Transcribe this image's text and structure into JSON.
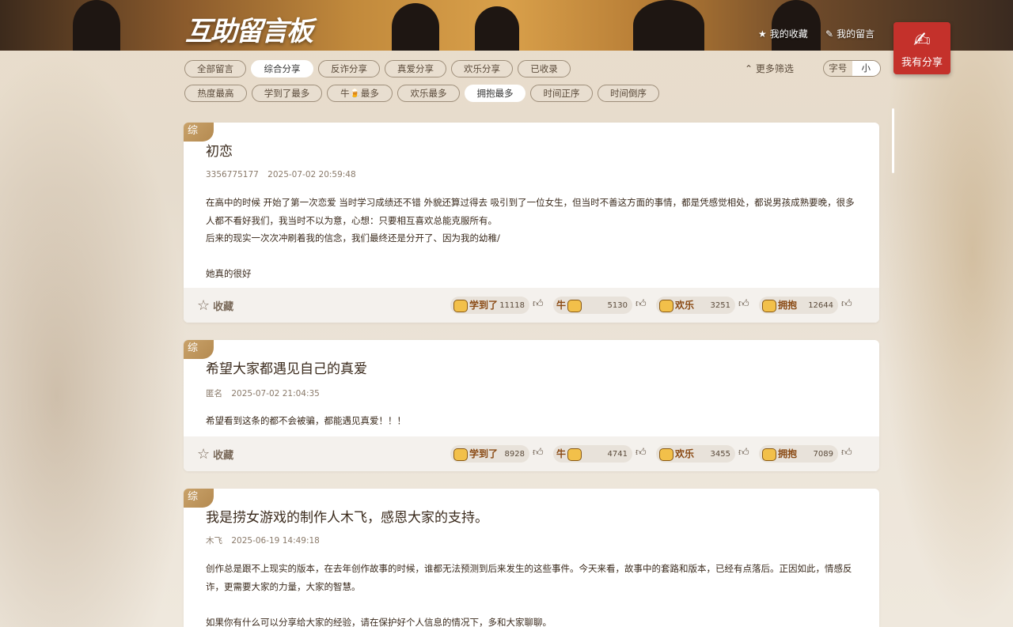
{
  "header": {
    "logo": "互助留言板",
    "my_favorites": "我的收藏",
    "my_messages": "我的留言",
    "share_button": "我有分享"
  },
  "filters": {
    "categories": [
      "全部留言",
      "综合分享",
      "反诈分享",
      "真爱分享",
      "欢乐分享",
      "已收录"
    ],
    "active_category": "综合分享",
    "sorts": [
      "热度最高",
      "学到了最多",
      "牛🍺最多",
      "欢乐最多",
      "拥抱最多",
      "时间正序",
      "时间倒序"
    ],
    "active_sort": "拥抱最多",
    "more_filter": "更多筛选",
    "font_label": "字号",
    "font_size": "小"
  },
  "icons": {
    "star": "star-icon",
    "note": "note-edit-icon",
    "chevron": "chevron-up-icon",
    "thumb": "thumb-up-icon",
    "share": "edit-document-icon"
  },
  "colors": {
    "share_button": "#c4312b",
    "corner_tag": "#c9a26a"
  },
  "reaction_labels": {
    "learned": "学到了",
    "cool": "牛",
    "fun": "欢乐",
    "hug": "拥抱",
    "favorite": "收藏"
  },
  "posts": [
    {
      "tag": "综",
      "title": "初恋",
      "author": "3356775177",
      "time": "2025-07-02 20:59:48",
      "body": [
        "在高中的时候 开始了第一次恋爱 当时学习成绩还不错 外貌还算过得去 吸引到了一位女生，但当时不善这方面的事情，都是凭感觉相处，都说男孩成熟要晚，很多人都不看好我们，我当时不以为意，心想：只要相互喜欢总能克服所有。",
        "后来的现实一次次冲刷着我的信念，我们最终还是分开了、因为我的幼稚/",
        "",
        "她真的很好"
      ],
      "learned": "11118",
      "cool": "5130",
      "fun": "3251",
      "hug": "12644"
    },
    {
      "tag": "综",
      "title": "希望大家都遇见自己的真爱",
      "author": "匿名",
      "time": "2025-07-02 21:04:35",
      "body": [
        "希望看到这条的都不会被骗，都能遇见真爱！！！"
      ],
      "learned": "8928",
      "cool": "4741",
      "fun": "3455",
      "hug": "7089"
    },
    {
      "tag": "综",
      "title": "我是捞女游戏的制作人木飞，感恩大家的支持。",
      "author": "木飞",
      "time": "2025-06-19 14:49:18",
      "body": [
        "创作总是跟不上现实的版本，在去年创作故事的时候，谁都无法预测到后来发生的这些事件。今天来看，故事中的套路和版本，已经有点落后。正因如此，情感反诈，更需要大家的力量，大家的智慧。",
        "",
        "如果你有什么可以分享给大家的经验，请在保护好个人信息的情况下，多和大家聊聊。"
      ]
    }
  ]
}
